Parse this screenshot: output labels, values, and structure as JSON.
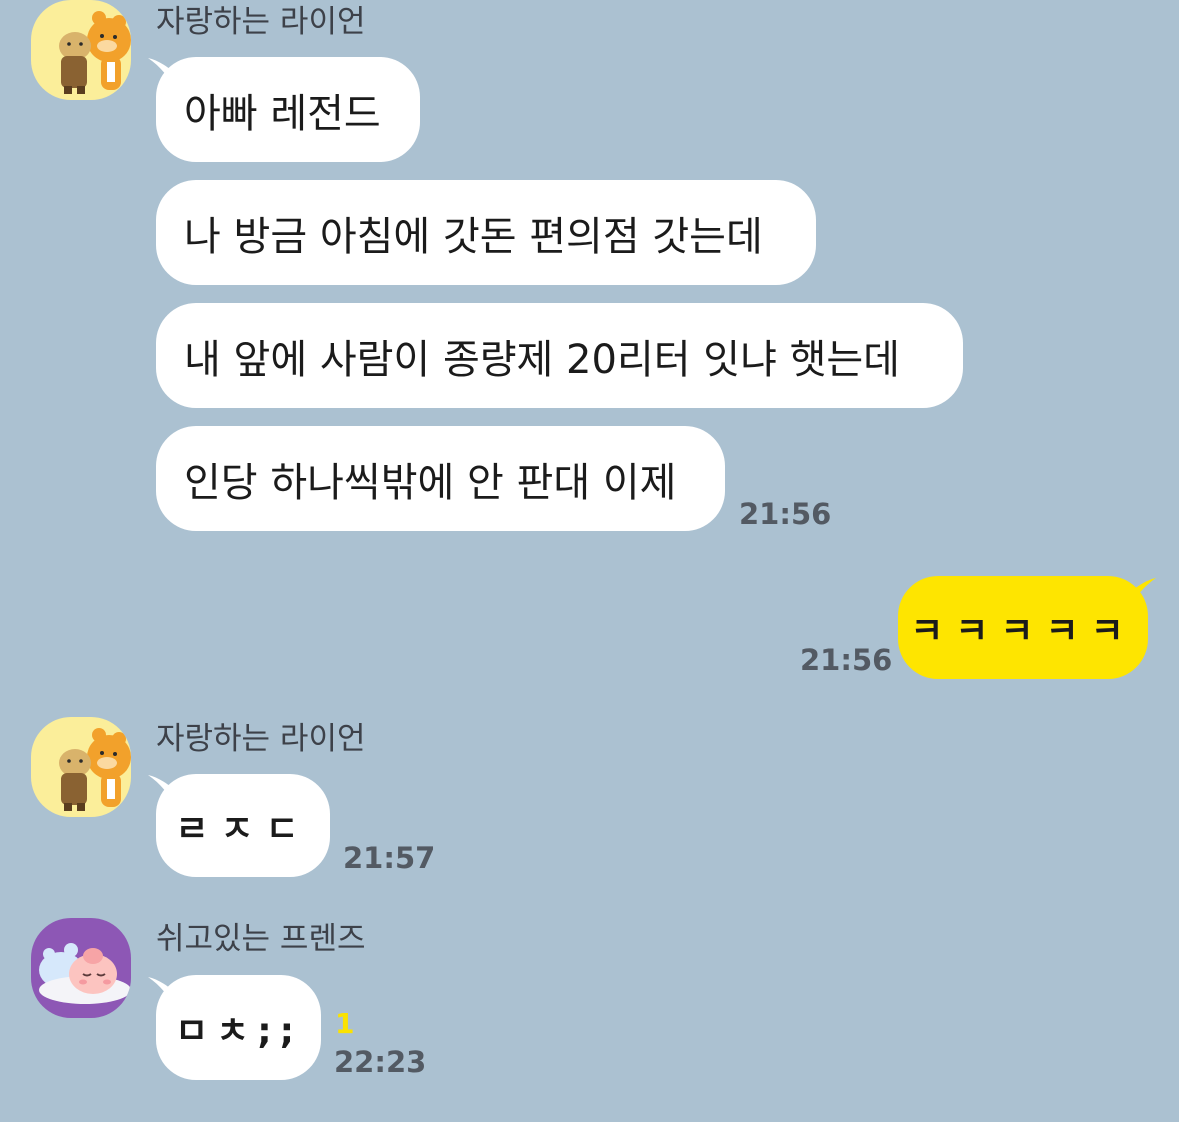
{
  "colors": {
    "background": "#abc1d1",
    "incoming_bubble": "#ffffff",
    "outgoing_bubble": "#fee500",
    "unread_count": "#fbe200",
    "timestamp": "#535a63"
  },
  "messages": {
    "group1": {
      "sender": "자랑하는 라이언",
      "avatar_icon": "ryan-holding-choonsik-icon",
      "lines": [
        "아빠 레전드",
        "나 방금 아침에 갓돈 편의점 갓는데",
        "내 앞에 사람이 종량제 20리터 잇냐 햇는데",
        "인당 하나씩밖에 안 판대 이제"
      ],
      "time": "21:56"
    },
    "mine1": {
      "text": "ㅋㅋㅋㅋㅋ",
      "time": "21:56"
    },
    "group2": {
      "sender": "자랑하는 라이언",
      "avatar_icon": "ryan-holding-choonsik-icon",
      "text": "ㄹㅈㄷ",
      "time": "21:57"
    },
    "group3": {
      "sender": "쉬고있는 프렌즈",
      "avatar_icon": "sleeping-apeach-icon",
      "text": "ㅁㅊ;;",
      "unread": "1",
      "time": "22:23"
    }
  }
}
